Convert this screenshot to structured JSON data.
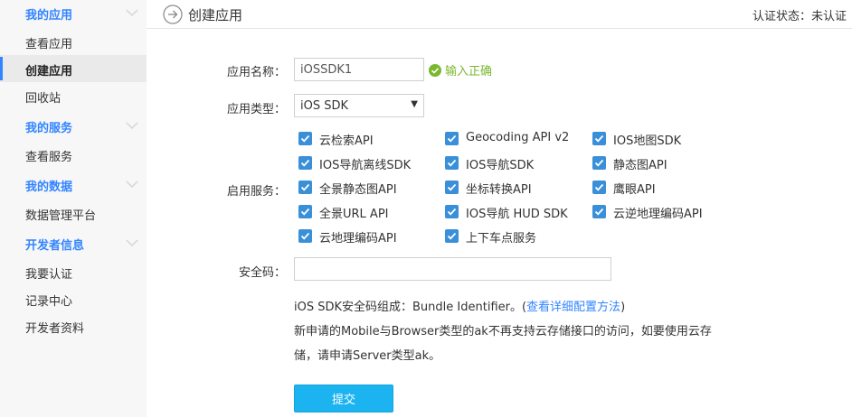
{
  "sidebar": {
    "sections": [
      {
        "title": "我的应用",
        "items": [
          "查看应用",
          "创建应用",
          "回收站"
        ]
      },
      {
        "title": "我的服务",
        "items": [
          "查看服务"
        ]
      },
      {
        "title": "我的数据",
        "items": [
          "数据管理平台"
        ]
      },
      {
        "title": "开发者信息",
        "items": [
          "我要认证",
          "记录中心",
          "开发者资料"
        ]
      }
    ]
  },
  "header": {
    "title": "创建应用",
    "status": "认证状态：未认证"
  },
  "form": {
    "app_name_label": "应用名称：",
    "app_name_value": "iOSSDK1",
    "app_name_valid": "输入正确",
    "app_type_label": "应用类型：",
    "app_type_value": "iOS SDK",
    "services_label": "启用服务：",
    "services": [
      [
        "云检索API",
        "Geocoding API v2",
        "IOS地图SDK"
      ],
      [
        "IOS导航离线SDK",
        "IOS导航SDK",
        "静态图API"
      ],
      [
        "全景静态图API",
        "坐标转换API",
        "鹰眼API"
      ],
      [
        "全景URL API",
        "IOS导航 HUD SDK",
        "云逆地理编码API"
      ],
      [
        "云地理编码API",
        "上下车点服务"
      ]
    ],
    "security_label": "安全码：",
    "security_value": "",
    "note_line1_prefix": "iOS SDK安全码组成：Bundle Identifier。(",
    "note_line1_link": "查看详细配置方法",
    "note_line1_suffix": ")",
    "note_line2": "新申请的Mobile与Browser类型的ak不再支持云存储接口的访问，如要使用云存",
    "note_line3": "储，请申请Server类型ak。",
    "submit_label": "提交"
  },
  "colors": {
    "accent": "#3385ff",
    "checkbox": "#3a8fd9",
    "valid": "#7ab82e",
    "submit": "#1cb4f0"
  }
}
